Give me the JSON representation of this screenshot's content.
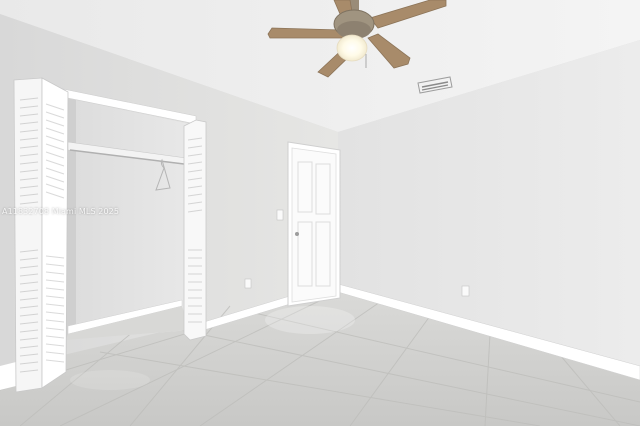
{
  "watermark": {
    "text": "A11832708 Miami MLS 2025"
  },
  "palette": {
    "ceiling": "#efefef",
    "left_wall": "#e4e4e4",
    "right_wall": "#e8e8e8",
    "floor": "#d3d3d1",
    "trim": "#ffffff",
    "fan_wood": "#a88b6a",
    "fan_metal": "#9a8c78"
  },
  "scene": {
    "subject": "empty bedroom",
    "elements": [
      "ceiling-fan-with-light",
      "air-vent",
      "bifold-closet-doors",
      "closet-rod",
      "hanger",
      "interior-door",
      "light-switch",
      "outlets",
      "baseboards",
      "tile-floor"
    ]
  }
}
